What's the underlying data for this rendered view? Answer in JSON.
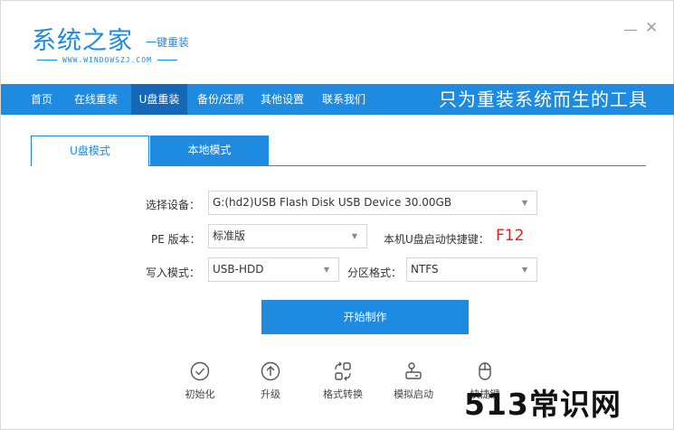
{
  "app": {
    "logo_main": "系统之家",
    "logo_sub": "一键重装",
    "logo_url": "WWW.WINDOWSZJ.COM",
    "minimize_glyph": "—",
    "close_glyph": "✕"
  },
  "nav": {
    "items": [
      "首页",
      "在线重装",
      "U盘重装",
      "备份/还原",
      "其他设置",
      "联系我们"
    ],
    "active": "U盘重装",
    "slogan": "只为重装系统而生的工具"
  },
  "tabs": [
    {
      "label": "U盘模式",
      "active": true
    },
    {
      "label": "本地模式",
      "active": false
    }
  ],
  "form": {
    "device_label": "选择设备：",
    "device_value": "G:(hd2)USB Flash Disk USB Device 30.00GB",
    "pe_label": "PE 版本：",
    "pe_value": "标准版",
    "hotkey_label": "本机U盘启动快捷键：",
    "hotkey_value": "F12",
    "write_label": "写入模式：",
    "write_value": "USB-HDD",
    "partition_label": "分区格式：",
    "partition_value": "NTFS"
  },
  "start_button": "开始制作",
  "tools": [
    {
      "label": "初始化",
      "icon": "check-circle-icon"
    },
    {
      "label": "升级",
      "icon": "upgrade-icon"
    },
    {
      "label": "格式转换",
      "icon": "convert-icon"
    },
    {
      "label": "模拟启动",
      "icon": "simulate-boot-icon"
    },
    {
      "label": "快捷键",
      "icon": "mouse-icon"
    }
  ],
  "watermark": "513常识网",
  "colors": {
    "accent": "#1e8ae0",
    "nav_active": "#1568b8",
    "hotkey": "#e02020"
  }
}
